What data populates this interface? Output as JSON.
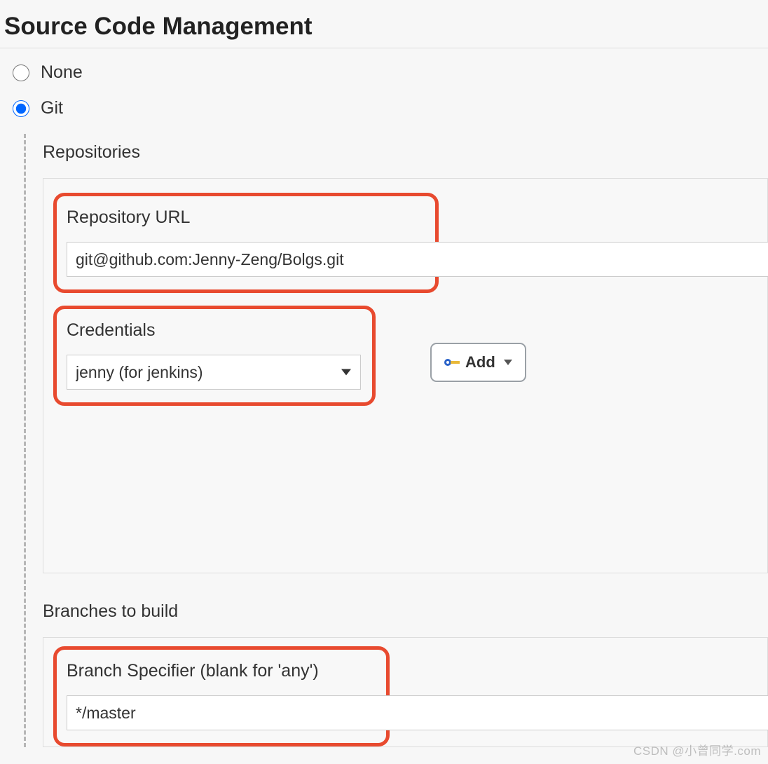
{
  "section": {
    "title": "Source Code Management"
  },
  "scm": {
    "none_label": "None",
    "git_label": "Git",
    "selected": "git"
  },
  "repositories": {
    "heading": "Repositories",
    "url_label": "Repository URL",
    "url_value": "git@github.com:Jenny-Zeng/Bolgs.git",
    "credentials_label": "Credentials",
    "credentials_selected": "jenny (for jenkins)",
    "add_button": "Add"
  },
  "branches": {
    "heading": "Branches to build",
    "specifier_label": "Branch Specifier (blank for 'any')",
    "specifier_value": "*/master"
  },
  "watermark": "CSDN @小曾同学.com"
}
